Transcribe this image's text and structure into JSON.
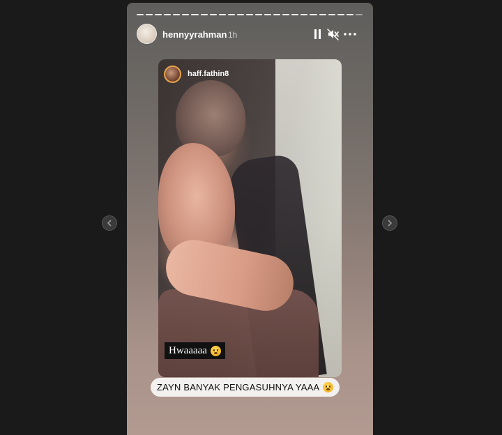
{
  "story": {
    "username": "hennyyrahman",
    "time": "1h",
    "progress_segments": 25,
    "progress_active_segments": 24
  },
  "shared_post": {
    "username": "haff.fathin8"
  },
  "stickers": {
    "hwa_text": "Hwaaaaa",
    "hwa_emoji": "face-with-open-mouth-emoji",
    "caption_text": "ZAYN BANYAK PENGASUHNYA YAAA",
    "caption_emoji": "grimacing-face-emoji"
  },
  "icons": {
    "pause": "pause-icon",
    "mute": "mute-icon",
    "more": "more-horizontal-icon",
    "prev": "chevron-left-icon",
    "next": "chevron-right-icon"
  },
  "colors": {
    "background": "#1a1a1a",
    "text": "#ffffff",
    "caption_bg": "#f3f1ef",
    "ring": "#e8a348"
  }
}
